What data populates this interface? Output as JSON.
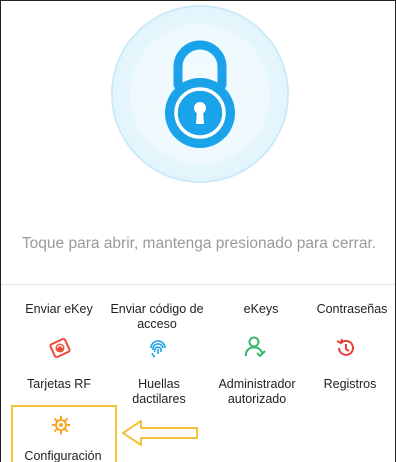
{
  "unlock": {
    "hint": "Toque para abrir, mantenga presionado para cerrar."
  },
  "menu_row1": [
    {
      "label": "Enviar eKey"
    },
    {
      "label": "Enviar código de acceso"
    },
    {
      "label": "eKeys"
    },
    {
      "label": "Contraseñas"
    }
  ],
  "menu_row2": [
    {
      "label": "Tarjetas RF",
      "icon": "rf-card-icon"
    },
    {
      "label": "Huellas dactilares",
      "icon": "fingerprint-icon"
    },
    {
      "label": "Administrador autorizado",
      "icon": "authorized-admin-icon"
    },
    {
      "label": "Registros",
      "icon": "records-history-icon"
    }
  ],
  "menu_row3": [
    {
      "label": "Configuración",
      "icon": "settings-icon"
    }
  ],
  "colors": {
    "accent_blue": "#1aa3e8",
    "rf_red": "#e8503a",
    "fingerprint_blue": "#1aa3e8",
    "admin_green": "#3bb36b",
    "records_red": "#e8403a",
    "settings_orange": "#f5a623",
    "highlight_yellow": "#f2c23a"
  }
}
